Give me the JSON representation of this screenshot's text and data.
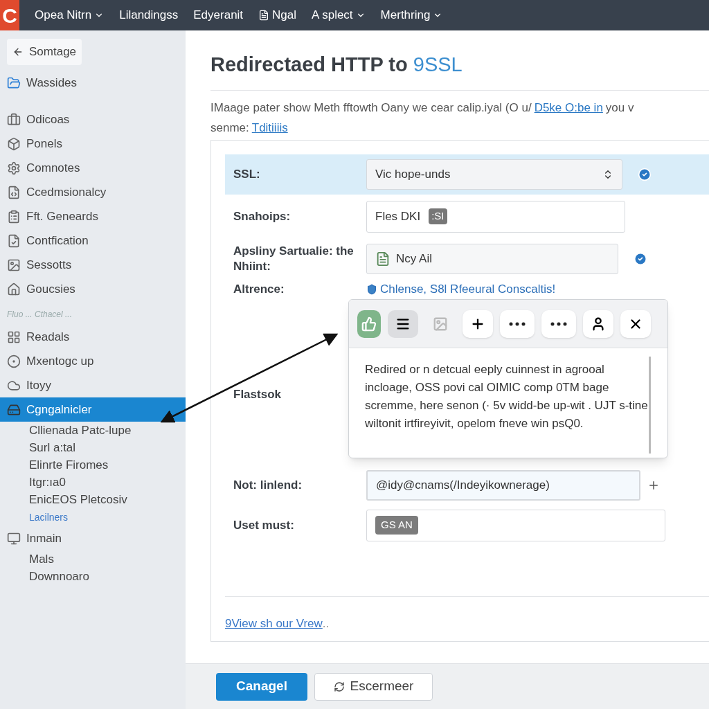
{
  "logo": "C",
  "menu": [
    {
      "label": "Opea Nitrn",
      "dropdown": true,
      "kind": "text"
    },
    {
      "label": "Lilandingss",
      "dropdown": false,
      "kind": "text"
    },
    {
      "label": "Edyeranit",
      "dropdown": false,
      "kind": "text"
    },
    {
      "label": "Ngal",
      "dropdown": false,
      "kind": "icon"
    },
    {
      "label": "A splect",
      "dropdown": true,
      "kind": "text"
    },
    {
      "label": "Merthring",
      "dropdown": true,
      "kind": "text"
    }
  ],
  "sidebar": {
    "items": [
      {
        "kind": "back",
        "label": "Somtage",
        "selected": false
      },
      {
        "kind": "item",
        "label": "Wassides",
        "selected": false
      },
      {
        "kind": "item",
        "label": "Odicoas",
        "selected": false
      },
      {
        "kind": "item",
        "label": "Ponels",
        "selected": false
      },
      {
        "kind": "item",
        "label": "Comnotes",
        "selected": false
      },
      {
        "kind": "item",
        "label": "Ccedmsionalcy",
        "selected": false
      },
      {
        "kind": "item",
        "label": "Fft. Geneards",
        "selected": false
      },
      {
        "kind": "item",
        "label": "Contfication",
        "selected": false
      },
      {
        "kind": "item",
        "label": "Sessotts",
        "selected": false
      },
      {
        "kind": "item",
        "label": "Goucsies",
        "selected": false
      },
      {
        "kind": "group",
        "label": "Fluo ... Cthacel ..."
      },
      {
        "kind": "item",
        "label": "Readals",
        "selected": false
      },
      {
        "kind": "item",
        "label": "Mxentogc up",
        "selected": false
      },
      {
        "kind": "item",
        "label": "Itoyy",
        "selected": false
      },
      {
        "kind": "item",
        "label": "Cgngalnicler",
        "selected": true
      },
      {
        "kind": "sub",
        "label": "Cllienada Patc-lupe",
        "selected": false
      },
      {
        "kind": "sub",
        "label": "Surl a:tal",
        "selected": false
      },
      {
        "kind": "sub",
        "label": "Elinrte Firomes",
        "selected": false
      },
      {
        "kind": "sub",
        "label": "Itgr:ıa0",
        "selected": false
      },
      {
        "kind": "sub",
        "label": "EnicEOS Pletcosiv",
        "selected": false
      },
      {
        "kind": "link",
        "label": "Lacilners",
        "selected": false
      },
      {
        "kind": "item",
        "label": "Inmain",
        "selected": false
      },
      {
        "kind": "sub",
        "label": "Mals",
        "selected": false
      },
      {
        "kind": "sub",
        "label": "Downnoaro",
        "selected": false
      }
    ]
  },
  "page": {
    "title": "Redirectaed HTTP to",
    "title_accent": "9SSL",
    "description": [
      [
        {
          "kind": "text",
          "text": "IMaage pater show Meth fftowth Oany we cear calip.iyal (O u/"
        },
        {
          "kind": "link",
          "text": "D5ke O:be in"
        },
        {
          "kind": "text",
          "text": "you v"
        }
      ],
      [
        {
          "kind": "text",
          "text": "senme:"
        },
        {
          "kind": "link",
          "text": "Tditiiiis"
        }
      ]
    ]
  },
  "form": {
    "rows": [
      {
        "kind": "select",
        "label": "SSL:",
        "value": "Vic hope-unds",
        "highlighted": true,
        "info": true
      },
      {
        "kind": "tag-input",
        "label": "Snahoips:",
        "value": "Fles DKI",
        "tag": ":SI",
        "highlighted": false,
        "info": false
      },
      {
        "kind": "icon-input",
        "label": "Apsliny Sartualie: the Nhiint:",
        "value": "Ncy Ail",
        "highlighted": false,
        "info": true
      },
      {
        "kind": "link",
        "label": "Altrence:",
        "value": "Chlense, S8l Rfeeural Conscaltis!",
        "highlighted": false,
        "info": false
      },
      {
        "kind": "blank",
        "label": "Flastsok",
        "highlighted": false,
        "info": false
      },
      {
        "kind": "focused-input",
        "label": "Not: linlend:",
        "value": "@idy@cnams(/Indeyikownerage)",
        "highlighted": false,
        "info": false
      },
      {
        "kind": "chip-input",
        "label": "Uset must:",
        "tag": "GS AN",
        "highlighted": false,
        "info": false
      }
    ],
    "footer_link": "9View sh our Vrew",
    "footer_link_suffix": ".."
  },
  "popup": {
    "tools": [
      {
        "kind": "thumb",
        "selected": false
      },
      {
        "kind": "menu",
        "selected": true
      },
      {
        "kind": "image",
        "selected": false
      },
      {
        "kind": "plus",
        "selected": false
      },
      {
        "kind": "dots",
        "selected": false
      },
      {
        "kind": "dots",
        "selected": false
      },
      {
        "kind": "person",
        "selected": false
      },
      {
        "kind": "close",
        "selected": false
      }
    ],
    "text": "Redired or n detcual eeply cuinnest in agrooal incloage, OSS povi cal OIMIC comp 0TM bage scremme, here senon (· 5v widd-be up-wit . UJT s-tine wiltonit irtfireyivit, opelom fneve win psQ0."
  },
  "buttons": [
    {
      "label": "Canagel",
      "kind": "primary"
    },
    {
      "label": "Escermeer",
      "kind": "secondary"
    }
  ]
}
